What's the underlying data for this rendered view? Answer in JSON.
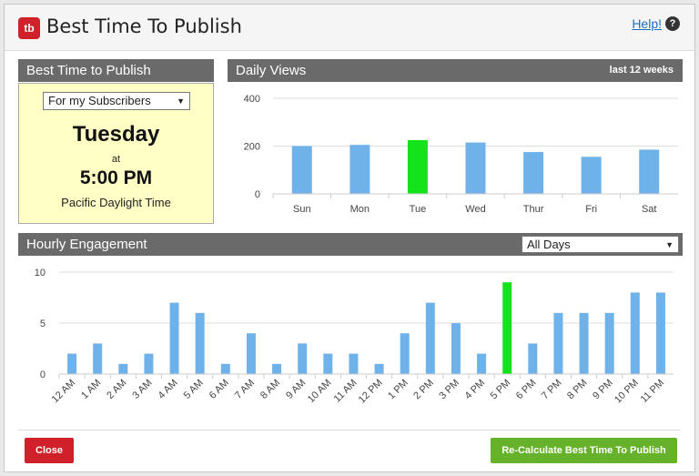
{
  "window": {
    "title": "Best Time To Publish",
    "help_label": "Help!",
    "help_icon": "?"
  },
  "logo": {
    "text": "tb",
    "color": "#d0202a"
  },
  "best_panel": {
    "header": "Best Time to Publish",
    "audience_select": "For my Subscribers",
    "day": "Tuesday",
    "at": "at",
    "time": "5:00 PM",
    "timezone": "Pacific Daylight Time"
  },
  "daily_panel": {
    "header": "Daily Views",
    "range": "last 12 weeks"
  },
  "hourly_panel": {
    "header": "Hourly Engagement",
    "filter_select": "All Days"
  },
  "footer": {
    "close_label": "Close",
    "recalc_label": "Re-Calculate Best Time To Publish"
  },
  "colors": {
    "bar": "#6fb2ea",
    "highlight": "#14e31c",
    "header_bg": "#6a6a6a",
    "close": "#d0202a",
    "recalc": "#66b22a"
  },
  "chart_data": [
    {
      "type": "bar",
      "categories": [
        "Sun",
        "Mon",
        "Tue",
        "Wed",
        "Thur",
        "Fri",
        "Sat"
      ],
      "values": [
        200,
        205,
        225,
        215,
        175,
        155,
        185
      ],
      "highlight_index": 2,
      "yticks": [
        "0",
        "200",
        "400"
      ],
      "ylim": [
        0,
        400
      ],
      "grid": true
    },
    {
      "type": "bar",
      "categories": [
        "12 AM",
        "1 AM",
        "2 AM",
        "3 AM",
        "4 AM",
        "5 AM",
        "6 AM",
        "7 AM",
        "8 AM",
        "9 AM",
        "10 AM",
        "11 AM",
        "12 PM",
        "1 PM",
        "2 PM",
        "3 PM",
        "4 PM",
        "5 PM",
        "6 PM",
        "7 PM",
        "8 PM",
        "9 PM",
        "10 PM",
        "11 PM"
      ],
      "values": [
        2,
        3,
        1,
        2,
        7,
        6,
        1,
        4,
        1,
        3,
        2,
        2,
        1,
        4,
        7,
        5,
        2,
        9,
        3,
        6,
        6,
        6,
        8,
        8
      ],
      "highlight_index": 17,
      "yticks": [
        "0",
        "5",
        "10"
      ],
      "ylim": [
        0,
        10
      ],
      "grid": true
    }
  ]
}
